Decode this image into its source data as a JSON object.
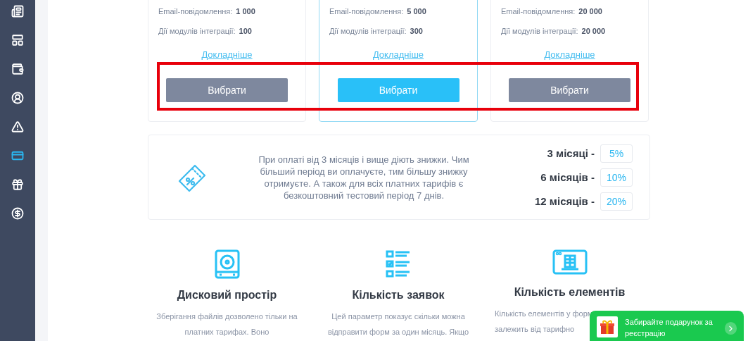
{
  "sidebar": {
    "items": [
      {
        "selected": false
      },
      {
        "selected": false
      },
      {
        "selected": false
      },
      {
        "selected": false
      },
      {
        "selected": false
      },
      {
        "selected": true
      },
      {
        "selected": false
      },
      {
        "selected": false
      }
    ]
  },
  "plans": [
    {
      "email_label": "Email-повідомлення:",
      "email_value": "1 000",
      "actions_label": "Дії модулів інтеграції:",
      "actions_value": "100",
      "link": "Докладніше",
      "button": "Вибрати",
      "selected": false
    },
    {
      "email_label": "Email-повідомлення:",
      "email_value": "5 000",
      "actions_label": "Дії модулів інтеграції:",
      "actions_value": "300",
      "link": "Докладніше",
      "button": "Вибрати",
      "selected": true
    },
    {
      "email_label": "Email-повідомлення:",
      "email_value": "20 000",
      "actions_label": "Дії модулів інтеграції:",
      "actions_value": "20 000",
      "link": "Докладніше",
      "button": "Вибрати",
      "selected": false
    }
  ],
  "highlight_frame": true,
  "discounts": {
    "text": "При оплаті від 3 місяців і вище діють знижки. Чим більший період ви оплачуєте, тим більшу знижку отримуєте. А також для всіх платних тарифів є безкоштовний тестовий період 7 днів.",
    "rows": [
      {
        "period": "3 місяці -",
        "discount": "5%"
      },
      {
        "period": "6 місяців -",
        "discount": "10%"
      },
      {
        "period": "12 місяців -",
        "discount": "20%"
      }
    ]
  },
  "features": [
    {
      "title": "Дисковий простір",
      "description": [
        "Зберігання файлів дозволено тільки на",
        "платних тарифах. Воно"
      ]
    },
    {
      "title": "Кількість заявок",
      "description": [
        "Цей параметр показує скільки можна",
        "відправити форм за один місяць. Якщо"
      ]
    },
    {
      "title": "Кількість елементів",
      "description": [
        "Кількість елементів у форм",
        "залежить від тарифно"
      ]
    }
  ],
  "promo": {
    "text": "Забирайте подарунок за реєстрацію"
  }
}
